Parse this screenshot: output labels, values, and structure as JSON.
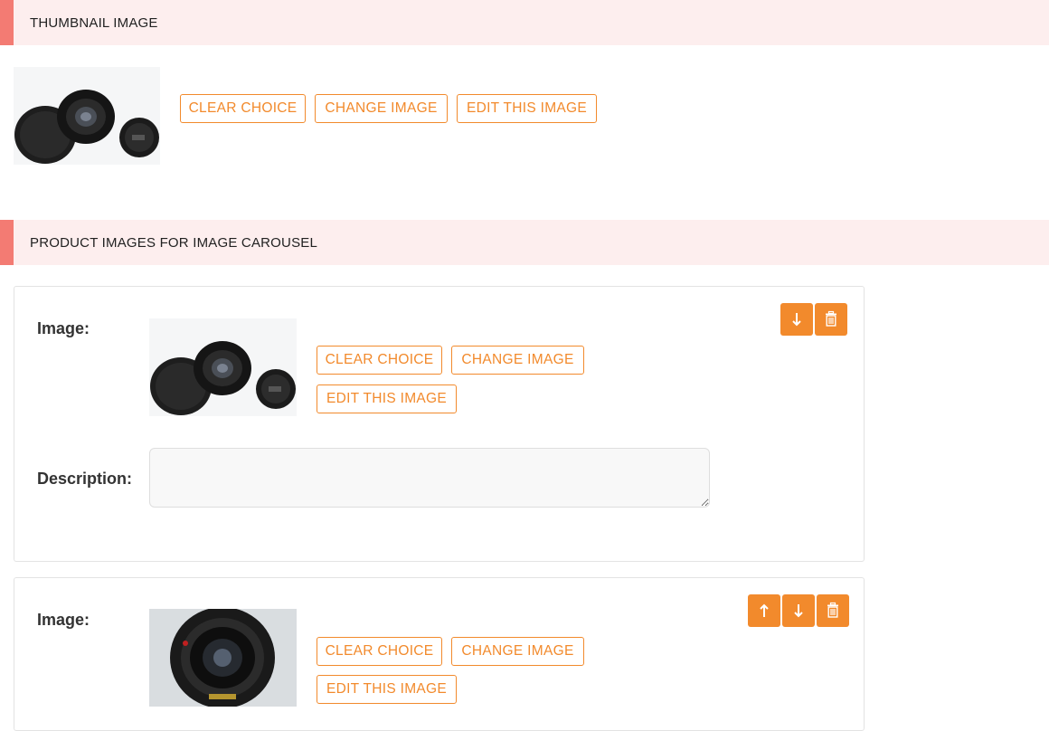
{
  "thumbnail_section": {
    "title": "THUMBNAIL IMAGE",
    "buttons": {
      "clear": "CLEAR CHOICE",
      "change": "CHANGE IMAGE",
      "edit": "EDIT THIS IMAGE"
    }
  },
  "carousel_section": {
    "title": "PRODUCT IMAGES FOR IMAGE CAROUSEL",
    "items": [
      {
        "image_label": "Image:",
        "description_label": "Description:",
        "description_value": "",
        "clear": "CLEAR CHOICE",
        "change": "CHANGE IMAGE",
        "edit": "EDIT THIS IMAGE",
        "controls": [
          "move-down-icon",
          "delete-icon"
        ]
      },
      {
        "image_label": "Image:",
        "clear": "CLEAR CHOICE",
        "change": "CHANGE IMAGE",
        "edit": "EDIT THIS IMAGE",
        "controls": [
          "move-up-icon",
          "move-down-icon",
          "delete-icon"
        ]
      }
    ]
  },
  "colors": {
    "accent": "#f28a2c",
    "header_bg": "#fdeeee",
    "header_bar": "#f37b73"
  }
}
